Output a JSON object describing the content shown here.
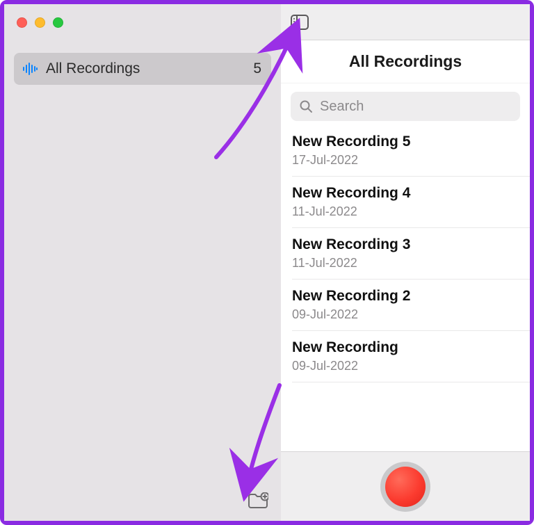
{
  "sidebar": {
    "folders": [
      {
        "label": "All Recordings",
        "count": "5"
      }
    ]
  },
  "main": {
    "title": "All Recordings",
    "search_placeholder": "Search",
    "recordings": [
      {
        "name": "New Recording 5",
        "date": "17-Jul-2022"
      },
      {
        "name": "New Recording 4",
        "date": "11-Jul-2022"
      },
      {
        "name": "New Recording 3",
        "date": "11-Jul-2022"
      },
      {
        "name": "New Recording 2",
        "date": "09-Jul-2022"
      },
      {
        "name": "New Recording",
        "date": "09-Jul-2022"
      }
    ]
  }
}
